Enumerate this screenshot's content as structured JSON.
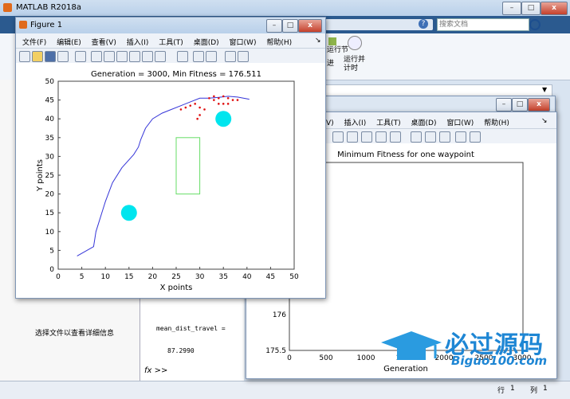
{
  "app": {
    "title": "MATLAB R2018a",
    "search_placeholder": "搜索文档",
    "ribbon": {
      "run_section": "运行节",
      "advance": "进",
      "run_time": "运行并计时"
    },
    "left_info": "选择文件以查看详细信息",
    "cmd": {
      "var": "mean_dist_travel =",
      "value": "87.2990",
      "prompt": "fx >>"
    },
    "status": {
      "row_label": "行",
      "row": "1",
      "col_label": "列",
      "col": "1"
    }
  },
  "figure1": {
    "title": "Figure 1",
    "menu": [
      "文件(F)",
      "编辑(E)",
      "查看(V)",
      "插入(I)",
      "工具(T)",
      "桌面(D)",
      "窗口(W)",
      "帮助(H)"
    ],
    "menu_arrow": "↘",
    "plot_title": "Generation = 3000, Min Fitness = 176.511",
    "xlabel": "X points",
    "ylabel": "Y points",
    "xticks": [
      "0",
      "5",
      "10",
      "15",
      "20",
      "25",
      "30",
      "35",
      "40",
      "45",
      "50"
    ],
    "yticks": [
      "0",
      "5",
      "10",
      "15",
      "20",
      "25",
      "30",
      "35",
      "40",
      "45",
      "50"
    ]
  },
  "figure2": {
    "menu": [
      "V)",
      "插入(I)",
      "工具(T)",
      "桌面(D)",
      "窗口(W)",
      "帮助(H)"
    ],
    "plot_title": "Minimum Fitness for one waypoint",
    "xlabel": "Generation",
    "xticks": [
      "0",
      "500",
      "1000",
      "1500",
      "2000",
      "2500",
      "3000"
    ],
    "yticks": [
      "175.5",
      "176"
    ]
  },
  "watermark": {
    "main": "必过源码",
    "sub": "Biguo100.com"
  },
  "chart_data": {
    "type": "line",
    "title": "Generation = 3000, Min Fitness = 176.511",
    "xlabel": "X points",
    "ylabel": "Y points",
    "xlim": [
      0,
      50
    ],
    "ylim": [
      0,
      50
    ],
    "path": {
      "x": [
        4,
        7.5,
        8,
        9,
        10,
        11.5,
        13.5,
        16,
        17,
        17.5,
        18.5,
        20,
        22,
        24,
        26,
        28,
        30,
        32,
        34,
        36,
        38,
        40.5
      ],
      "y": [
        3.5,
        6,
        10,
        14,
        18,
        23,
        27,
        30.5,
        32.5,
        34.5,
        37.5,
        40,
        41.5,
        42.5,
        43.5,
        44.5,
        45.5,
        45.5,
        45.7,
        46,
        45.8,
        45.2
      ]
    },
    "points": [
      {
        "x": 26,
        "y": 42.5
      },
      {
        "x": 27,
        "y": 43
      },
      {
        "x": 28,
        "y": 43.5
      },
      {
        "x": 29,
        "y": 44
      },
      {
        "x": 30,
        "y": 43
      },
      {
        "x": 31,
        "y": 42.5
      },
      {
        "x": 32,
        "y": 45.5
      },
      {
        "x": 33,
        "y": 46
      },
      {
        "x": 34,
        "y": 45.5
      },
      {
        "x": 35,
        "y": 46
      },
      {
        "x": 36,
        "y": 45.5
      },
      {
        "x": 37,
        "y": 45
      },
      {
        "x": 38,
        "y": 45
      },
      {
        "x": 29.5,
        "y": 40
      },
      {
        "x": 30,
        "y": 41
      },
      {
        "x": 33,
        "y": 45
      },
      {
        "x": 34,
        "y": 44
      },
      {
        "x": 35,
        "y": 44
      },
      {
        "x": 36,
        "y": 44
      }
    ],
    "obstacles": [
      {
        "x": 15,
        "y": 15
      },
      {
        "x": 35,
        "y": 40
      }
    ],
    "rect": {
      "x0": 25,
      "x1": 30,
      "y0": 20,
      "y1": 35
    },
    "colors": {
      "path": "#3535d8",
      "points": "#e01010",
      "obstacle": "#00e5ee",
      "rect": "#66dd66"
    }
  }
}
